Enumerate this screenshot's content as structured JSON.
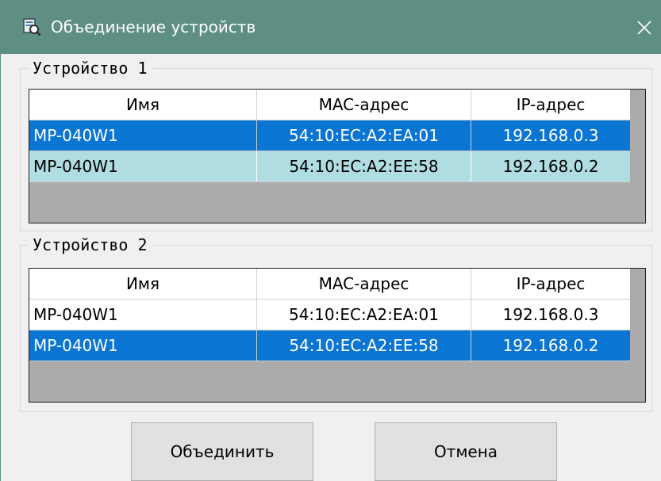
{
  "window": {
    "title": "Объединение устройств",
    "icon": "device-merge-icon",
    "close_glyph": "✕",
    "colors": {
      "titlebar": "#5e8f82",
      "selected_row": "#0a75d2",
      "alt_row": "#b0dde2"
    }
  },
  "columns": {
    "name": "Имя",
    "mac": "MAC-адрес",
    "ip": "IP-адрес"
  },
  "group1": {
    "legend": "Устройство 1",
    "rows": [
      {
        "name": "MP-040W1",
        "mac": "54:10:EC:A2:EA:01",
        "ip": "192.168.0.3",
        "state": "selected"
      },
      {
        "name": "MP-040W1",
        "mac": "54:10:EC:A2:EE:58",
        "ip": "192.168.0.2",
        "state": "alternate"
      }
    ]
  },
  "group2": {
    "legend": "Устройство 2",
    "rows": [
      {
        "name": "MP-040W1",
        "mac": "54:10:EC:A2:EA:01",
        "ip": "192.168.0.3",
        "state": "normal"
      },
      {
        "name": "MP-040W1",
        "mac": "54:10:EC:A2:EE:58",
        "ip": "192.168.0.2",
        "state": "selected"
      }
    ]
  },
  "buttons": {
    "merge": "Объединить",
    "cancel": "Отмена"
  }
}
